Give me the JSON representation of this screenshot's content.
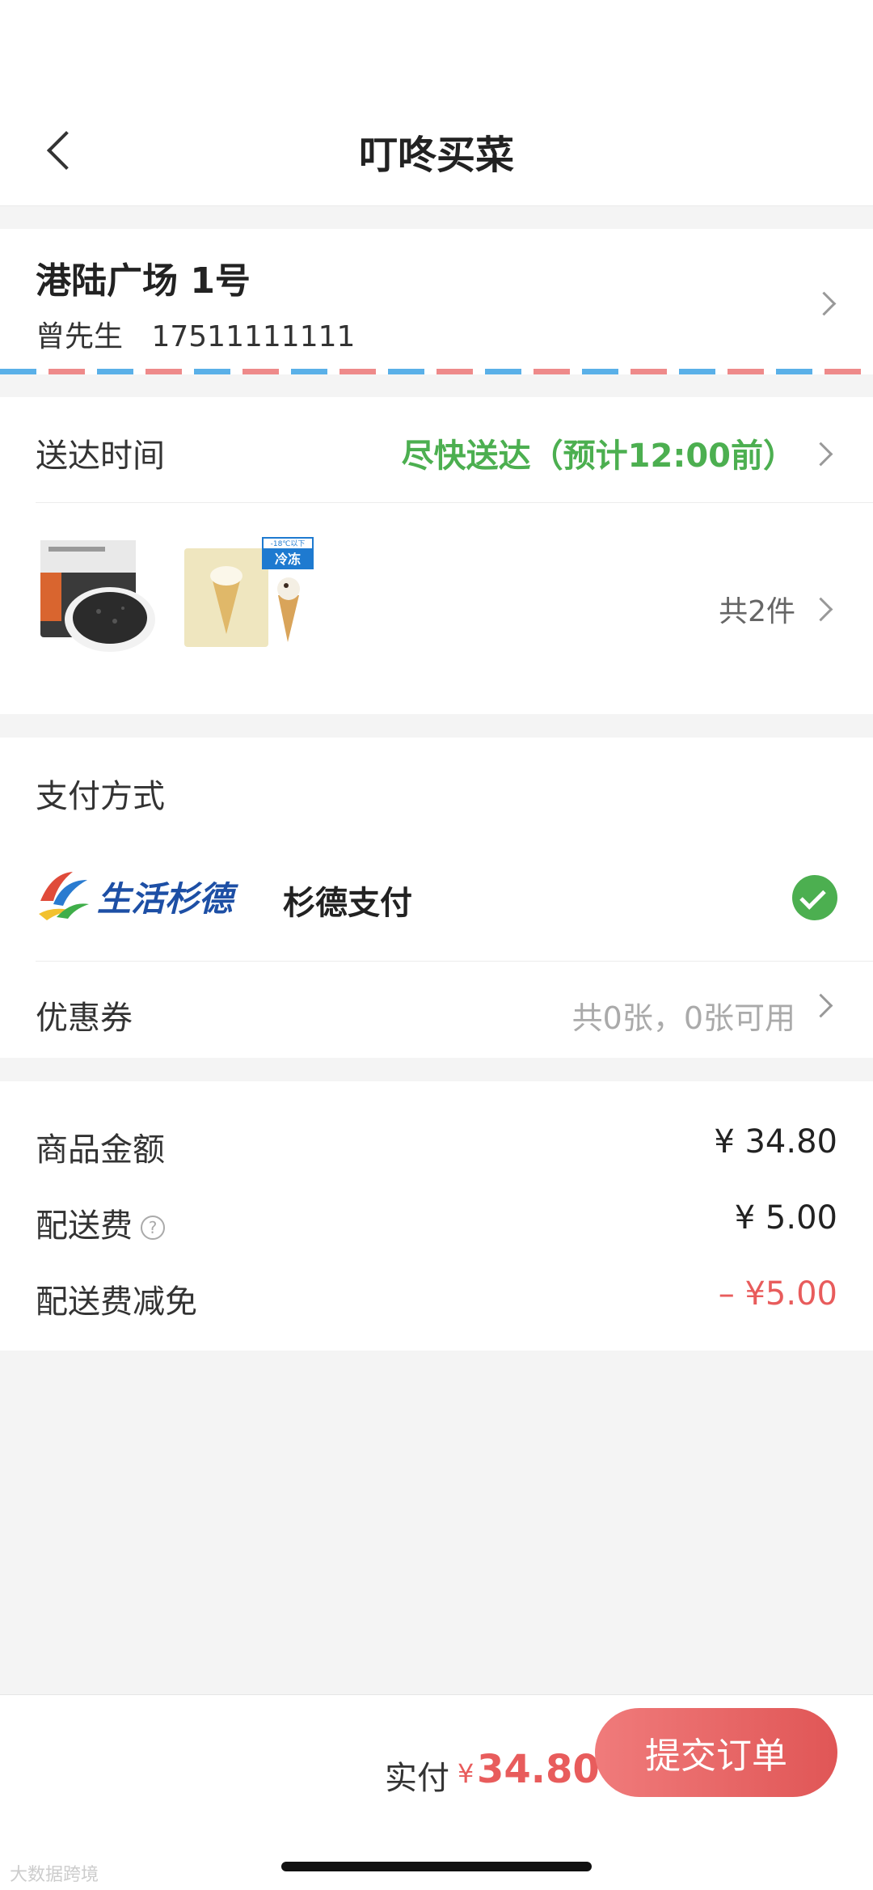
{
  "header": {
    "title": "叮咚买菜"
  },
  "address": {
    "title": "港陆广场 1号",
    "name": "曾先生",
    "phone": "17511111111"
  },
  "delivery": {
    "label": "送达时间",
    "value": "尽快送达（预计12:00前）"
  },
  "goods": {
    "count_text": "共2件",
    "frozen_tag": "冷冻",
    "frozen_temp": "-18℃以下"
  },
  "payment": {
    "title": "支付方式",
    "logo_text": "生活杉德",
    "method_name": "杉德支付"
  },
  "coupon": {
    "label": "优惠券",
    "value": "共0张，0张可用"
  },
  "amounts": {
    "goods_label": "商品金额",
    "goods_value": "¥ 34.80",
    "shipping_label": "配送费",
    "shipping_value": "¥ 5.00",
    "shipping_discount_label": "配送费减免",
    "shipping_discount_value": "– ¥5.00",
    "help_glyph": "?"
  },
  "bottom": {
    "total_label": "实付",
    "total_currency": "¥",
    "total_value": "34.80",
    "submit_label": "提交订单"
  },
  "watermark": "大数据跨境"
}
